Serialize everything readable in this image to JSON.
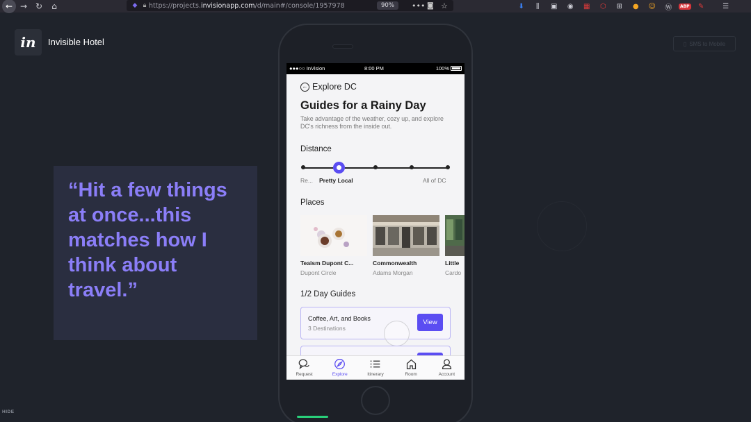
{
  "browser": {
    "url_prefix": "https://projects.",
    "url_host": "invisionapp.com",
    "url_path": "/d/main#/console/1957978",
    "zoom": "90%",
    "extension_badge": "ABP"
  },
  "header": {
    "logo_text": "in",
    "project_title": "Invisible Hotel",
    "sms_button": "SMS to Mobile"
  },
  "quote": {
    "text": "“Hit a few things at once...this matches how I think about travel.”"
  },
  "footer": {
    "hide_label": "HIDE"
  },
  "phone": {
    "status": {
      "carrier": "●●●○○ InVision",
      "time": "8:00 PM",
      "battery": "100%"
    },
    "back_label": "Explore DC",
    "title": "Guides for a Rainy Day",
    "description": "Take advantage of the weather, cozy up, and explore DC's richness from the inside out.",
    "distance": {
      "heading": "Distance",
      "labels": [
        "Re...",
        "Pretty Local",
        "All of DC"
      ],
      "selected_index": 1,
      "steps": 5
    },
    "places": {
      "heading": "Places",
      "items": [
        {
          "name": "Teaism Dupont C...",
          "area": "Dupont Circle"
        },
        {
          "name": "Commonwealth",
          "area": "Adams Morgan"
        },
        {
          "name": "Little",
          "area": "Cardo"
        }
      ]
    },
    "guides": {
      "heading": "1/2 Day Guides",
      "items": [
        {
          "title": "Coffee, Art, and Books",
          "subtitle": "3 Destinations",
          "button": "View"
        }
      ]
    },
    "tabs": [
      {
        "label": "Request",
        "icon": "chat-bubbles-icon"
      },
      {
        "label": "Explore",
        "icon": "compass-icon",
        "active": true
      },
      {
        "label": "Itinerary",
        "icon": "list-icon"
      },
      {
        "label": "Room",
        "icon": "house-icon"
      },
      {
        "label": "Account",
        "icon": "person-icon"
      }
    ]
  },
  "colors": {
    "background": "#1f232b",
    "accent": "#5b4df2",
    "quote_text": "#8b7ef8",
    "quote_card": "#2a2e40"
  }
}
